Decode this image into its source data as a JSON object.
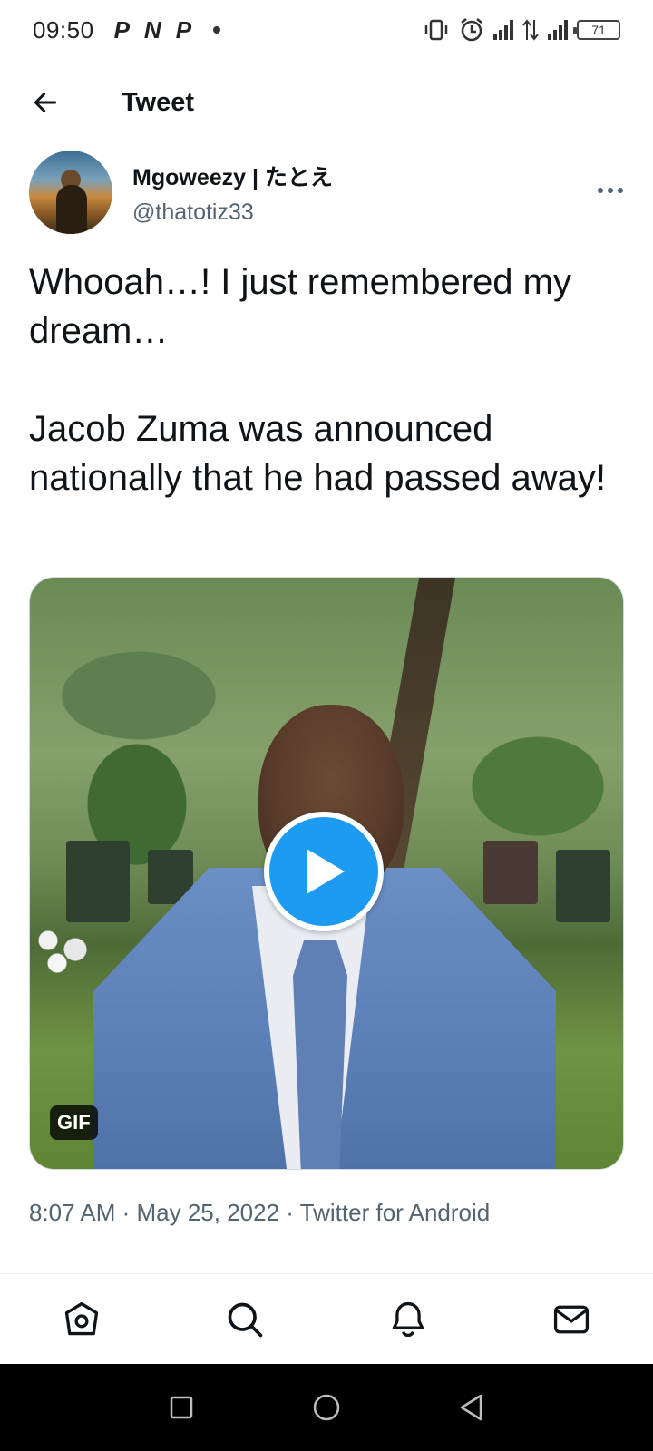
{
  "status_bar": {
    "time": "09:50",
    "app_icons": [
      "P",
      "N",
      "P"
    ],
    "battery": "71"
  },
  "header": {
    "title": "Tweet"
  },
  "tweet": {
    "display_name": "Mgoweezy | たとえ",
    "handle": "@thatotiz33",
    "text_line1": "Whooah…! I just remembered my dream…",
    "text_line2": "Jacob Zuma was announced nationally that he had passed away!",
    "media_badge": "GIF",
    "timestamp": "8:07 AM · May 25, 2022 · Twitter for Android"
  },
  "tabbar": {
    "items": [
      "home-icon",
      "search-icon",
      "notifications-icon",
      "messages-icon"
    ]
  },
  "colors": {
    "accent": "#1d9bf0",
    "text_primary": "#0f1419",
    "text_secondary": "#536471"
  }
}
